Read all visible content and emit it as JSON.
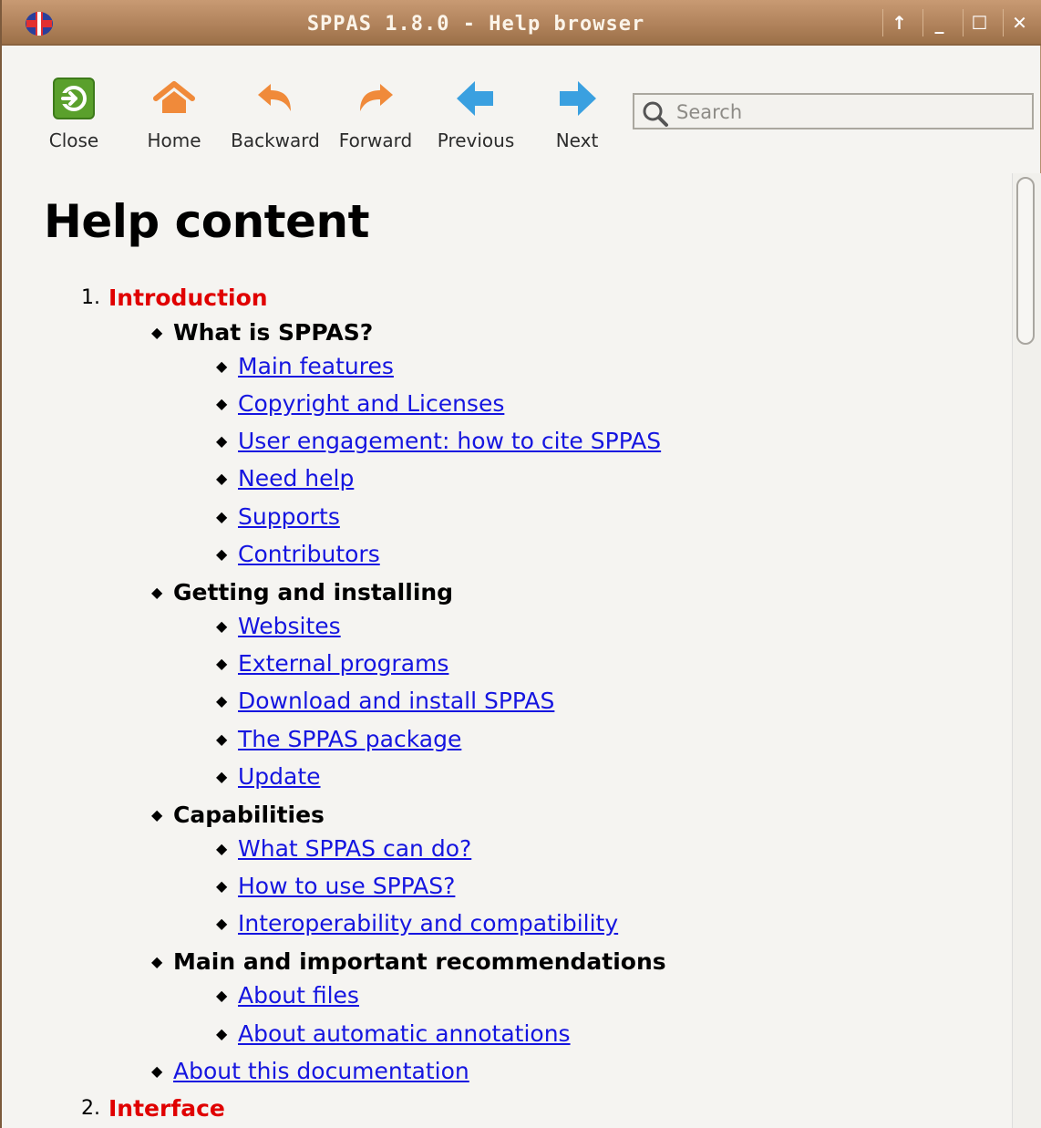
{
  "window": {
    "title": "SPPAS 1.8.0  - Help browser",
    "controls": {
      "up": "↑",
      "minimize": "_",
      "maximize": "☐",
      "close": "✕"
    }
  },
  "toolbar": {
    "close_label": "Close",
    "home_label": "Home",
    "backward_label": "Backward",
    "forward_label": "Forward",
    "previous_label": "Previous",
    "next_label": "Next",
    "search_placeholder": "Search"
  },
  "colors": {
    "section": "#e00000",
    "link": "#1515e0",
    "close_green": "#5aa02c",
    "home_orange": "#f08a3a",
    "arrow_blue": "#3aa0e0"
  },
  "content": {
    "title": "Help content",
    "sections": [
      {
        "number": "1.",
        "label": "Introduction"
      },
      {
        "number": "2.",
        "label": "Interface"
      }
    ],
    "headers": [
      "What is SPPAS?",
      "Getting and installing",
      "Capabilities",
      "Main and important recommendations"
    ],
    "links": [
      "Main features",
      "Copyright and Licenses",
      "User engagement: how to cite SPPAS",
      "Need help",
      "Supports",
      "Contributors",
      "Websites",
      "External programs",
      "Download and install SPPAS",
      "The SPPAS package",
      "Update",
      "What SPPAS can do?",
      "How to use SPPAS?",
      "Interoperability and compatibility",
      "About files",
      "About automatic annotations",
      "About this documentation"
    ]
  }
}
